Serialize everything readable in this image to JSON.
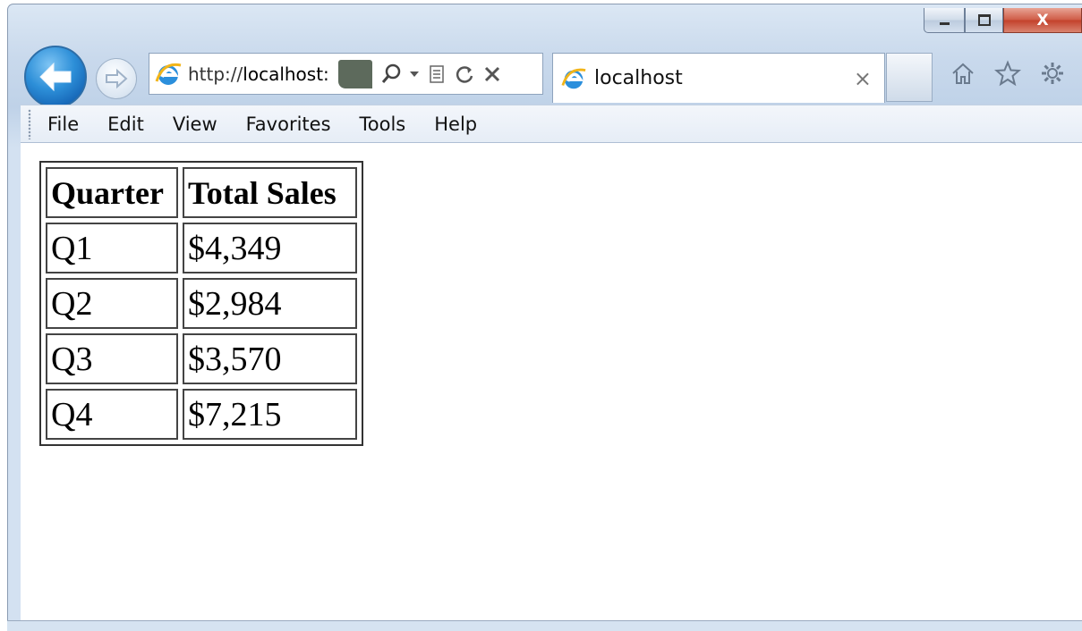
{
  "window": {
    "minimize_icon": "minimize-icon",
    "maximize_icon": "maximize-icon",
    "close_glyph": "X"
  },
  "navigation": {
    "back_icon": "back-arrow-icon",
    "forward_icon": "forward-arrow-icon"
  },
  "address_bar": {
    "url_prefix": "http://",
    "url_host": "localhost:",
    "icons": [
      "ie-logo-icon",
      "search-icon",
      "dropdown-icon",
      "compatibility-view-icon",
      "refresh-icon",
      "stop-icon"
    ]
  },
  "tab": {
    "title": "localhost",
    "close_glyph": "×"
  },
  "toolbar_icons": [
    "home-icon",
    "favorites-star-icon",
    "tools-gear-icon"
  ],
  "menu": {
    "items": [
      "File",
      "Edit",
      "View",
      "Favorites",
      "Tools",
      "Help"
    ]
  },
  "colors": {
    "back_button": "#1f7fd0",
    "close_button": "#c9503a",
    "chrome": "#c9d9ec"
  },
  "sales_table": {
    "headers": [
      "Quarter",
      "Total Sales"
    ],
    "rows": [
      [
        "Q1",
        "$4,349"
      ],
      [
        "Q2",
        "$2,984"
      ],
      [
        "Q3",
        "$3,570"
      ],
      [
        "Q4",
        "$7,215"
      ]
    ]
  }
}
